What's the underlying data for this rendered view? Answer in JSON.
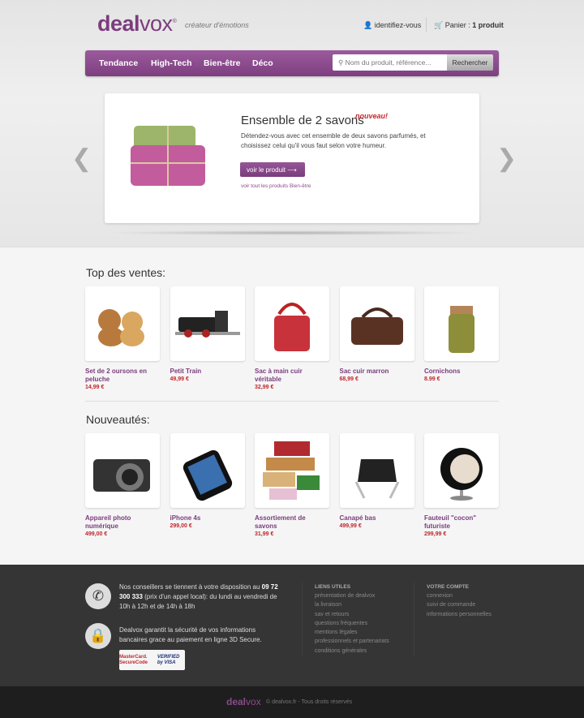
{
  "header": {
    "logo_bold": "deal",
    "logo_light": "vox",
    "logo_reg": "®",
    "tagline": "créateur d'émotions",
    "account": "identifiez-vous",
    "cart_label": "Panier : ",
    "cart_count": "1 produit"
  },
  "nav": {
    "items": [
      "Tendance",
      "High-Tech",
      "Bien-être",
      "Déco"
    ],
    "search_placeholder": "Nom du produit, référence...",
    "search_button": "Rechercher"
  },
  "slider": {
    "title": "Ensemble de 2 savons",
    "badge": "nouveau!",
    "description": "Détendez-vous avec cet ensemble de deux savons parfumés, et choisissez celui qu'il vous faut selon votre humeur.",
    "cta": "voir le produit",
    "link": "voir tout les produits Bien-être"
  },
  "top_sales": {
    "title": "Top des ventes:",
    "items": [
      {
        "name": "Set de 2 oursons en peluche",
        "price": "14,99 €",
        "icon": "teddy-bears"
      },
      {
        "name": "Petit Train",
        "price": "49,99 €",
        "icon": "train"
      },
      {
        "name": "Sac à main cuir véritable",
        "price": "32,99 €",
        "icon": "red-handbag"
      },
      {
        "name": "Sac cuir marron",
        "price": "68,99 €",
        "icon": "brown-bag"
      },
      {
        "name": "Cornichons",
        "price": "8.99 €",
        "icon": "pickle-jar"
      }
    ]
  },
  "new_items": {
    "title": "Nouveautés:",
    "items": [
      {
        "name": "Appareil photo numérique",
        "price": "499,00 €",
        "icon": "camera"
      },
      {
        "name": "iPhone 4s",
        "price": "299,00 €",
        "icon": "phone"
      },
      {
        "name": "Assortiement de savons",
        "price": "31,99 €",
        "icon": "soaps"
      },
      {
        "name": "Canapé bas",
        "price": "499,99 €",
        "icon": "chair"
      },
      {
        "name": "Fauteuil \"cocon\" futuriste",
        "price": "299,99 €",
        "icon": "egg-chair"
      }
    ]
  },
  "footer": {
    "contact_pre": "Nos conseillers se tiennent à votre disposition au ",
    "phone": "09 72 300 333",
    "contact_post": " (prix d'un appel local): du lundi au vendredi de 10h à 12h et de 14h à 18h",
    "security": "Dealvox garantit la sécurité de vos informations bancaires grace au paiement en ligne 3D Secure.",
    "badge_mc": "MasterCard. SecureCode",
    "badge_visa": "VERIFIED by VISA",
    "links_title": "LIENS UTILES",
    "links": [
      "présentation de dealvox",
      "la livraison",
      "sav et retours",
      "questions fréquentes",
      "mentions légales",
      "professionnels et partenariats",
      "conditions générales"
    ],
    "account_title": "VOTRE COMPTE",
    "account_links": [
      "connexion",
      "suivi de commande",
      "informations personnelles"
    ],
    "copyright": "© dealvox.fr - Tous droits réservés"
  },
  "colors": {
    "brand": "#7b3d7d",
    "price": "#c0272d"
  }
}
